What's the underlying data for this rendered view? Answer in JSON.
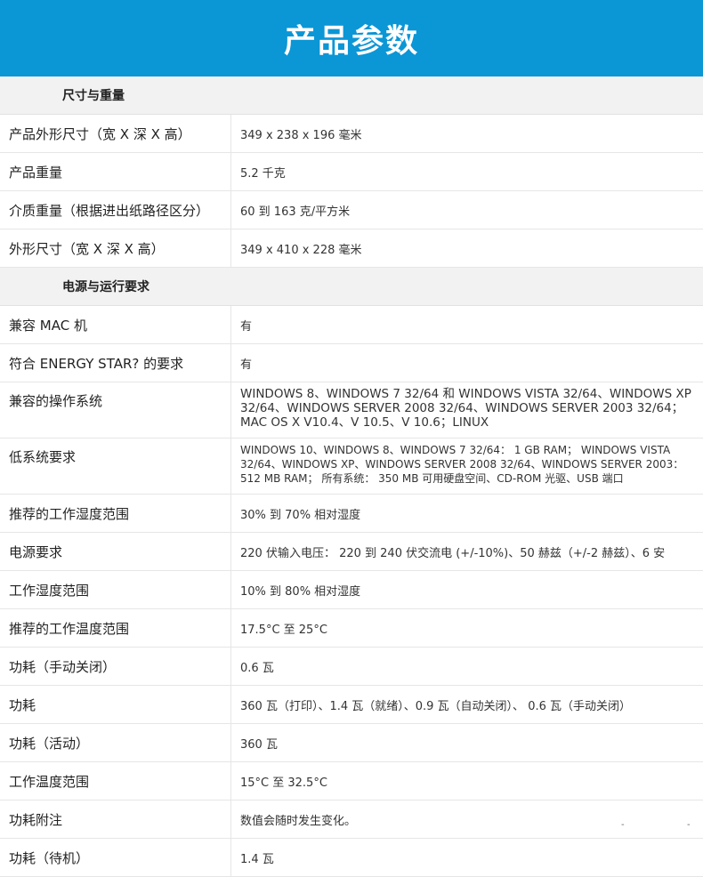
{
  "banner": {
    "title": "产品参数"
  },
  "sections": {
    "dimensions": "尺寸与重量",
    "power": "电源与运行要求"
  },
  "rows": [
    {
      "label": "产品外形尺寸（宽 X 深 X 高）",
      "value": "349 x 238 x 196 毫米"
    },
    {
      "label": "产品重量",
      "value": "5.2 千克"
    },
    {
      "label": "介质重量（根据进出纸路径区分）",
      "value": "60 到 163 克/平方米"
    },
    {
      "label": "外形尺寸（宽 X 深 X 高）",
      "value": "349 x 410 x 228 毫米"
    },
    {
      "label": "兼容 MAC 机",
      "value": "有"
    },
    {
      "label": "符合 ENERGY STAR? 的要求",
      "value": "有"
    },
    {
      "label": "兼容的操作系统",
      "value": "WINDOWS 8、WINDOWS 7 32/64 和 WINDOWS VISTA 32/64、WINDOWS XP 32/64、WINDOWS SERVER 2008 32/64、WINDOWS SERVER 2003 32/64；MAC OS X V10.4、V 10.5、V 10.6；LINUX"
    },
    {
      "label": "低系统要求",
      "value": "WINDOWS 10、WINDOWS 8、WINDOWS 7 32/64： 1 GB RAM； WINDOWS VISTA 32/64、WINDOWS XP、WINDOWS SERVER 2008 32/64、WINDOWS SERVER 2003： 512 MB RAM； 所有系统： 350 MB 可用硬盘空间、CD-ROM 光驱、USB 端口"
    },
    {
      "label": "推荐的工作湿度范围",
      "value": "30% 到 70% 相对湿度"
    },
    {
      "label": "电源要求",
      "value": "220 伏输入电压： 220 到 240 伏交流电 (+/-10%)、50 赫兹（+/-2 赫兹）、6 安"
    },
    {
      "label": "工作湿度范围",
      "value": "10% 到 80% 相对湿度"
    },
    {
      "label": "推荐的工作温度范围",
      "value": "17.5°C 至 25°C"
    },
    {
      "label": "功耗（手动关闭）",
      "value": "0.6 瓦"
    },
    {
      "label": "功耗",
      "value": "360 瓦（打印）、1.4 瓦（就绪）、0.9 瓦（自动关闭）、 0.6 瓦（手动关闭）"
    },
    {
      "label": "功耗（活动）",
      "value": "360 瓦"
    },
    {
      "label": "工作温度范围",
      "value": "15°C 至 32.5°C"
    },
    {
      "label": "功耗附注",
      "value": "数值会随时发生变化。",
      "dash1": "-",
      "dash2": "-"
    },
    {
      "label": "功耗（待机）",
      "value": "1.4 瓦"
    }
  ]
}
